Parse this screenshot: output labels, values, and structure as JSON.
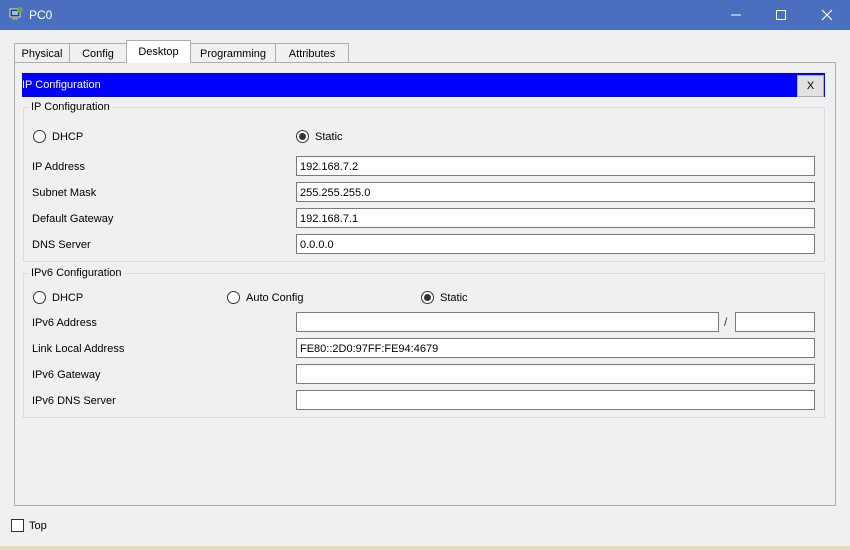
{
  "window": {
    "title": "PC0",
    "minimize_icon": "minimize-icon",
    "maximize_icon": "maximize-icon",
    "close_icon": "close-icon"
  },
  "tabs": [
    {
      "label": "Physical",
      "active": false
    },
    {
      "label": "Config",
      "active": false
    },
    {
      "label": "Desktop",
      "active": true
    },
    {
      "label": "Programming",
      "active": false
    },
    {
      "label": "Attributes",
      "active": false
    }
  ],
  "ip_config_window": {
    "title": "IP Configuration",
    "close_label": "X",
    "accent_color": "#0000ff"
  },
  "ipv4": {
    "group_title": "IP Configuration",
    "dhcp_label": "DHCP",
    "static_label": "Static",
    "selected_mode": "Static",
    "ip_address_label": "IP Address",
    "ip_address_value": "192.168.7.2",
    "subnet_mask_label": "Subnet Mask",
    "subnet_mask_value": "255.255.255.0",
    "default_gateway_label": "Default Gateway",
    "default_gateway_value": "192.168.7.1",
    "dns_server_label": "DNS Server",
    "dns_server_value": "0.0.0.0"
  },
  "ipv6": {
    "group_title": "IPv6 Configuration",
    "dhcp_label": "DHCP",
    "auto_config_label": "Auto Config",
    "static_label": "Static",
    "selected_mode": "Static",
    "address_label": "IPv6 Address",
    "address_value": "",
    "prefix_separator": "/",
    "prefix_value": "",
    "link_local_label": "Link Local Address",
    "link_local_value": "FE80::2D0:97FF:FE94:4679",
    "gateway_label": "IPv6 Gateway",
    "gateway_value": "",
    "dns_server_label": "IPv6 DNS Server",
    "dns_server_value": ""
  },
  "footer": {
    "top_label": "Top",
    "top_checked": false
  }
}
